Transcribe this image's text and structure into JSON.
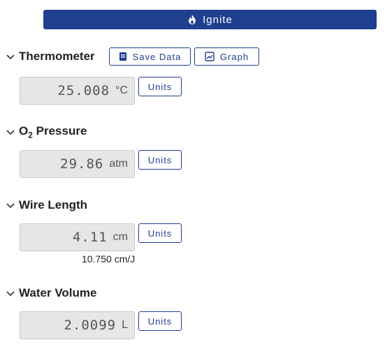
{
  "ignite": {
    "label": "Ignite"
  },
  "thermometer": {
    "title": "Thermometer",
    "save_label": "Save Data",
    "graph_label": "Graph",
    "value": "25.008",
    "unit": "°C",
    "units_label": "Units"
  },
  "o2": {
    "title_main": "O",
    "title_sub": "2",
    "title_rest": " Pressure",
    "value": "29.86",
    "unit": "atm",
    "units_label": "Units"
  },
  "wire": {
    "title": "Wire Length",
    "value": "4.11",
    "unit": "cm",
    "units_label": "Units",
    "note": "10.750 cm/J"
  },
  "water": {
    "title": "Water Volume",
    "value": "2.0099",
    "unit": "L",
    "units_label": "Units"
  },
  "colors": {
    "accent": "#1f3f8f",
    "readout_bg": "#e6e6e6"
  },
  "icons": [
    "flame-icon",
    "chevron-down-icon",
    "notebook-icon",
    "graph-icon"
  ]
}
